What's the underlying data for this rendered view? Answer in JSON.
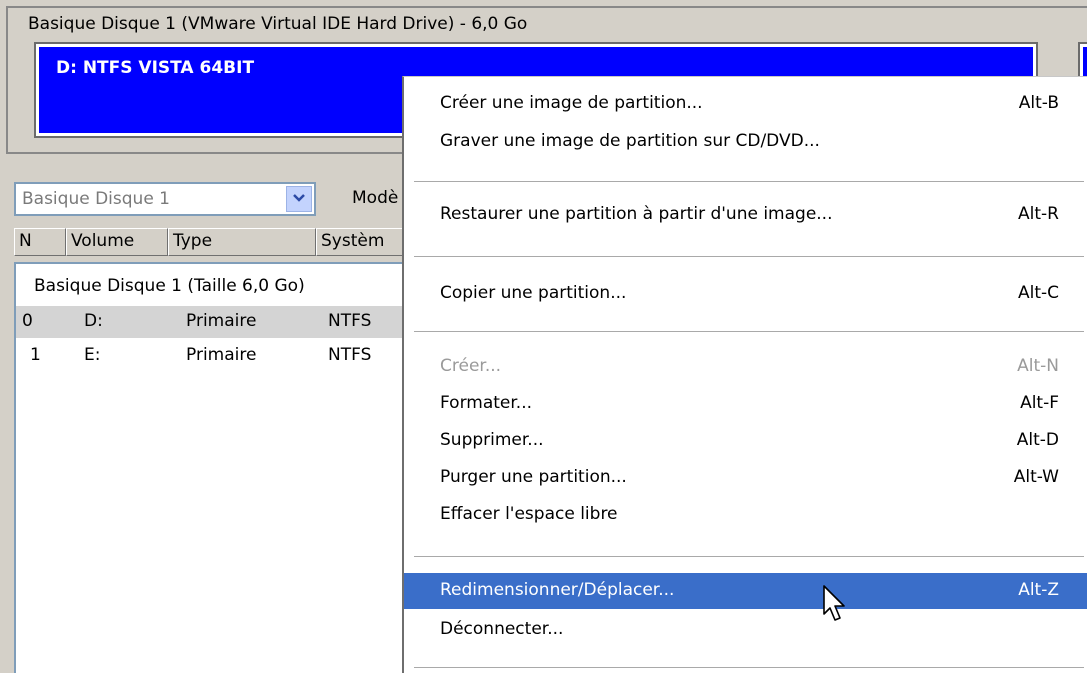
{
  "disk_map": {
    "disk_title": "Basique Disque 1 (VMware Virtual IDE Hard Drive) - 6,0 Go",
    "partition_label": "D: NTFS VISTA 64BIT",
    "partition_color": "#0000ff"
  },
  "toolbar": {
    "disk_select_value": "Basique Disque 1",
    "mode_label": "Modè"
  },
  "table": {
    "columns": [
      "N",
      "Volume",
      "Type",
      "Systèm"
    ],
    "group_label": "Basique Disque 1 (Taille 6,0 Go)",
    "rows": [
      [
        "0",
        "D:",
        "Primaire",
        "NTFS"
      ],
      [
        "1",
        "E:",
        "Primaire",
        "NTFS"
      ]
    ]
  },
  "context_menu": {
    "items": [
      {
        "label": "Créer une image de partition...",
        "shortcut": "Alt-B"
      },
      {
        "label": "Graver une image de partition sur CD/DVD...",
        "shortcut": ""
      },
      {
        "label": "Restaurer une partition à partir d'une image...",
        "shortcut": "Alt-R"
      },
      {
        "label": "Copier une partition...",
        "shortcut": "Alt-C"
      },
      {
        "label": "Créer...",
        "shortcut": "Alt-N",
        "disabled": true
      },
      {
        "label": "Formater...",
        "shortcut": "Alt-F"
      },
      {
        "label": "Supprimer...",
        "shortcut": "Alt-D"
      },
      {
        "label": "Purger une partition...",
        "shortcut": "Alt-W"
      },
      {
        "label": "Effacer l'espace libre",
        "shortcut": ""
      },
      {
        "label": "Redimensionner/Déplacer...",
        "shortcut": "Alt-Z",
        "selected": true
      },
      {
        "label": "Déconnecter...",
        "shortcut": ""
      }
    ],
    "highlight_color": "#3a6ec9"
  },
  "icons": {
    "dropdown": "chevron-down-icon",
    "cursor": "mouse-pointer-icon"
  }
}
